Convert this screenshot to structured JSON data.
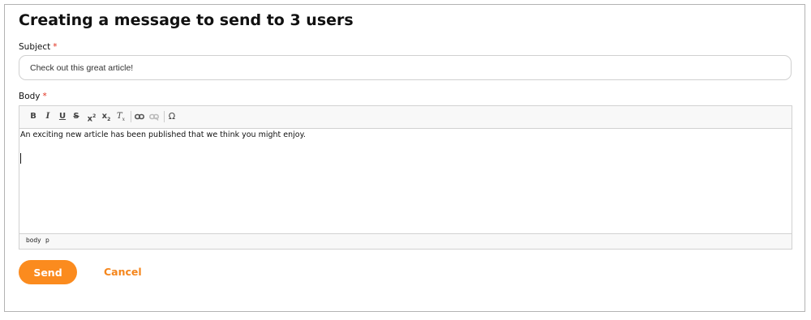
{
  "page": {
    "title": "Creating a message to send to 3 users"
  },
  "form": {
    "subject": {
      "label": "Subject",
      "required_mark": "*",
      "value": "Check out this great article!"
    },
    "body": {
      "label": "Body",
      "required_mark": "*",
      "text": "An exciting new article has been published that we think you might enjoy.",
      "toolbar": {
        "bold": "B",
        "italic": "I",
        "underline": "U",
        "strikethrough": "S",
        "superscript_base": "x",
        "superscript_mark": "2",
        "subscript_base": "x",
        "subscript_mark": "2",
        "clear_format_base": "T",
        "clear_format_mark": "x",
        "link_icon": "link-icon",
        "unlink_icon": "unlink-icon",
        "special_char": "Ω"
      },
      "path": [
        "body",
        "p"
      ]
    }
  },
  "actions": {
    "send_label": "Send",
    "cancel_label": "Cancel"
  },
  "colors": {
    "accent": "#fb8b1e",
    "required": "#e0301e",
    "border": "#b3b3b3"
  }
}
